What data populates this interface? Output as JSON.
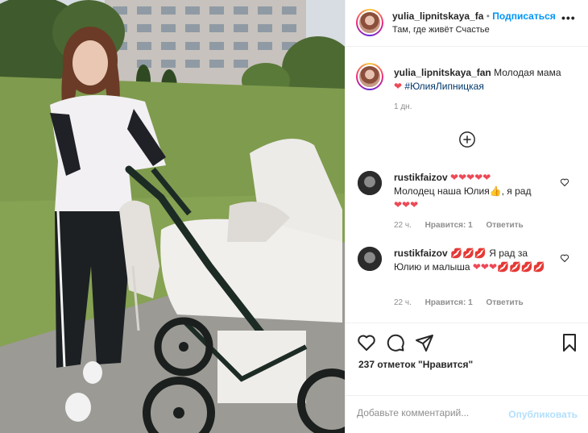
{
  "post": {
    "photo_alt": "",
    "author": "yulia_lipnitskaya_fa",
    "follow_label": "Подписаться",
    "location": "Там, где живёт Счастье",
    "more_label": "•••"
  },
  "caption": {
    "author": "yulia_lipnitskaya_fan",
    "text": "Молодая мама",
    "emoji": "❤",
    "hashtag": "#ЮлияЛипницкая",
    "time": "1 дн."
  },
  "load_more_icon": "plus-circle-icon",
  "comments": [
    {
      "author": "rustikfaizov",
      "emoji_line": "❤❤❤❤❤",
      "text": "Молодец наша Юлия👍, я рад",
      "emoji_tail": "❤❤❤",
      "time": "22 ч.",
      "likes": "Нравится: 1",
      "reply": "Ответить"
    },
    {
      "author": "rustikfaizov",
      "emoji_line": "💋💋💋",
      "text": "Я рад за Юлию и малыша",
      "emoji_tail": "❤❤❤💋💋💋💋",
      "time": "22 ч.",
      "likes": "Нравится: 1",
      "reply": "Ответить"
    }
  ],
  "actions": {
    "like_icon": "heart-outline-icon",
    "comment_icon": "comment-icon",
    "share_icon": "paper-plane-icon",
    "save_icon": "bookmark-icon",
    "likes_text": "237 отметок \"Нравится\""
  },
  "add_comment": {
    "placeholder": "Добавьте комментарий...",
    "publish_label": "Опубликовать"
  },
  "colors": {
    "accent": "#0095f6",
    "publish_disabled": "#b2dffc",
    "heart": "#ed4956"
  }
}
